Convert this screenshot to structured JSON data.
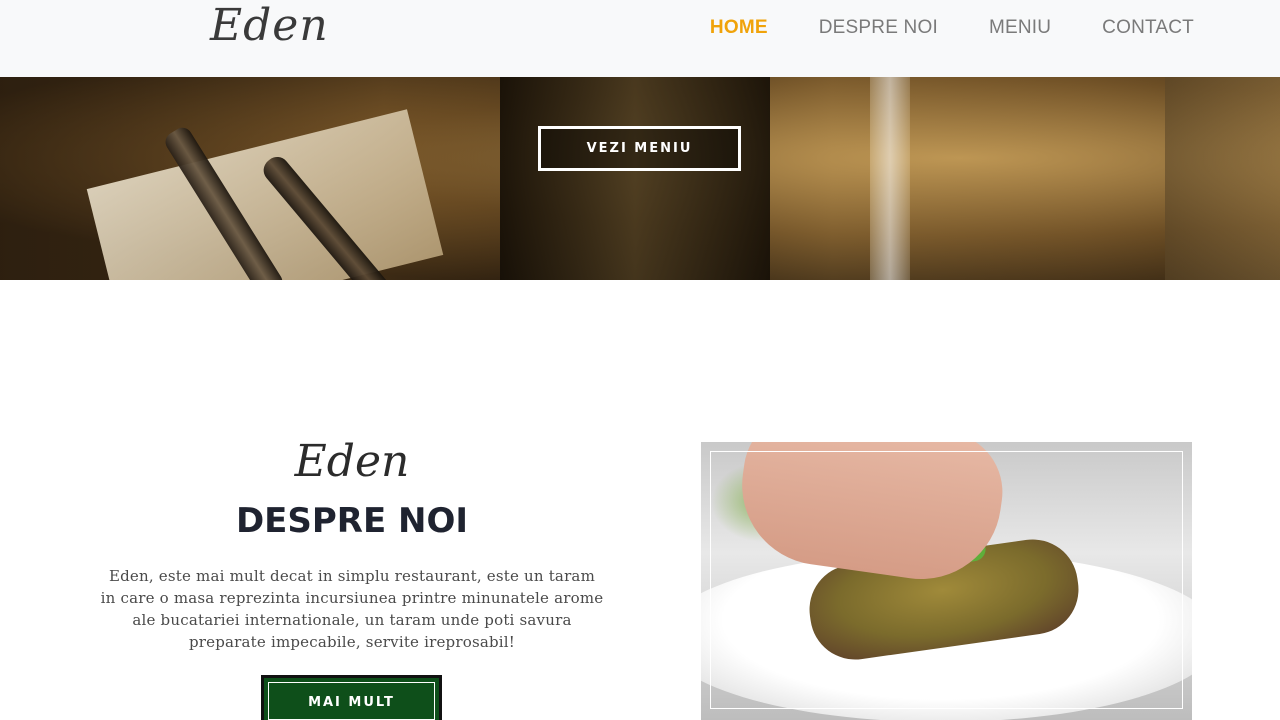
{
  "header": {
    "logo": "Eden",
    "nav": [
      {
        "label": "HOME",
        "active": true
      },
      {
        "label": "DESPRE NOI",
        "active": false
      },
      {
        "label": "MENIU",
        "active": false
      },
      {
        "label": "CONTACT",
        "active": false
      }
    ],
    "active_color": "#f0a30a"
  },
  "hero": {
    "button_label": "VEZI MENIU"
  },
  "about": {
    "script_title": "Eden",
    "title": "DESPRE NOI",
    "text": "Eden, este mai mult decat in simplu restaurant, este un taram in care o masa reprezinta incursiunea printre minunatele arome ale bucatariei internationale, un taram unde poti savura preparate impecabile, servite ireprosabil!",
    "button_label": "MAI MULT",
    "button_color": "#0e4f1a"
  }
}
